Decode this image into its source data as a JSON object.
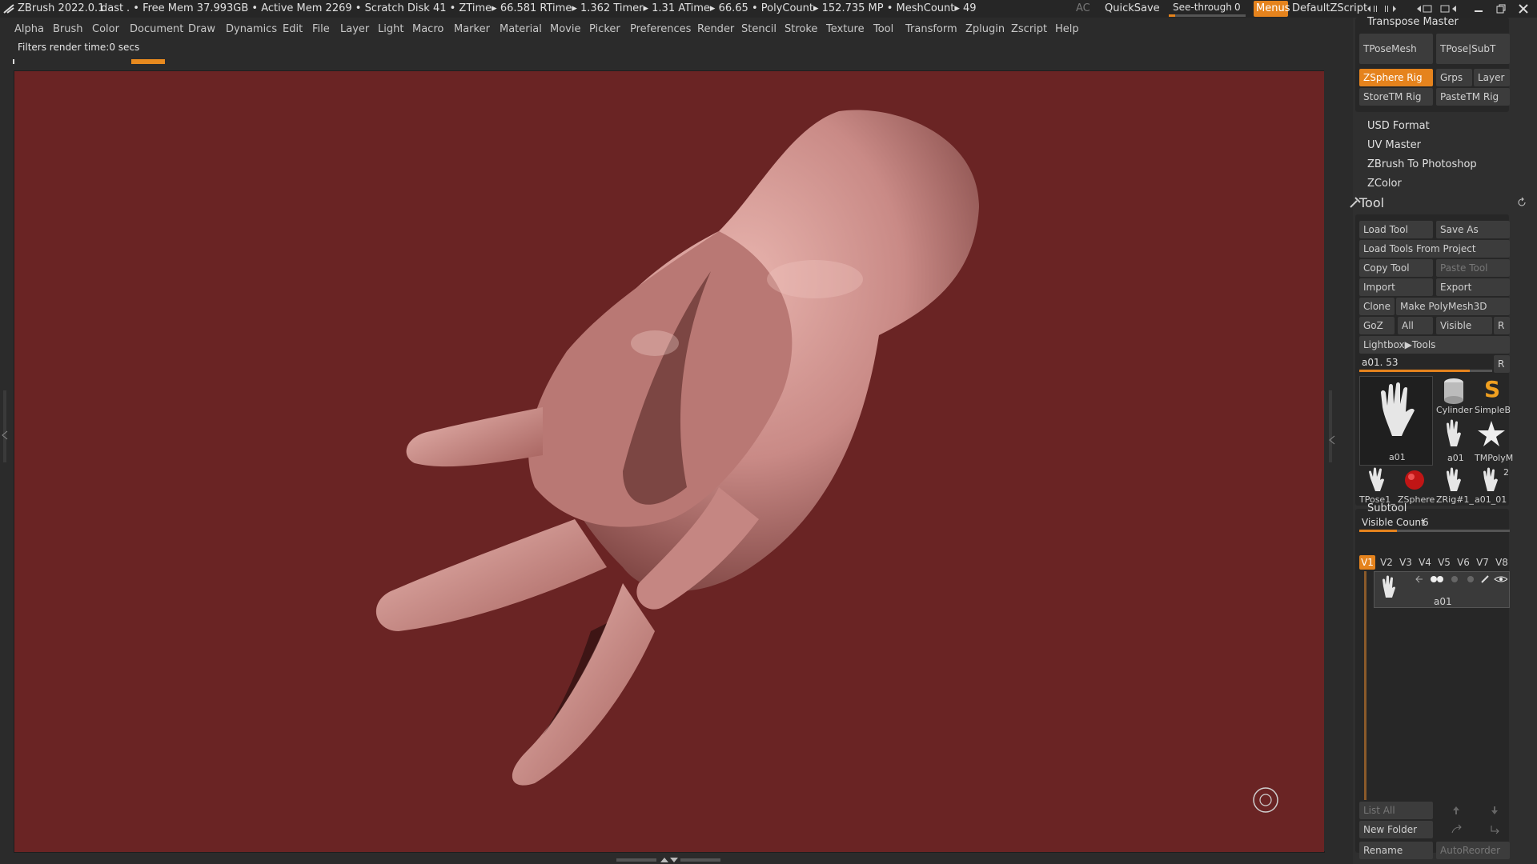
{
  "titlebar": {
    "app": "ZBrush 2022.0.1",
    "doc": "dast",
    "stats": ". • Free Mem 37.993GB • Active Mem 2269 • Scratch Disk 41 • ZTime▸ 66.581 RTime▸ 1.362 Timer▸ 1.31 ATime▸ 66.65 • PolyCount▸ 152.735 MP • MeshCount▸ 49",
    "ac": "AC",
    "quicksave": "QuickSave",
    "see_through_label": "See-through",
    "see_through_value": "0",
    "menus": "Menus",
    "default_zscript": "DefaultZScript"
  },
  "menubar": {
    "items": [
      "Alpha",
      "Brush",
      "Color",
      "Document",
      "Draw",
      "Dynamics",
      "Edit",
      "File",
      "Layer",
      "Light",
      "Macro",
      "Marker",
      "Material",
      "Movie",
      "Picker",
      "Preferences",
      "Render",
      "Stencil",
      "Stroke",
      "Texture",
      "Tool",
      "Transform",
      "Zplugin",
      "Zscript",
      "Help"
    ]
  },
  "note": "Filters render time:0 secs",
  "progress": 0.4,
  "colors": {
    "accent": "#e5831d",
    "canvas": "#6a2424",
    "panel": "#2f2f2f",
    "button": "#3c3c3c",
    "skin": "#c98a86"
  },
  "panel": {
    "transpose_master": "Transpose Master",
    "tposemesh": "TPoseMesh",
    "tpose_subt": "TPose|SubT",
    "zsphere_rig": "ZSphere Rig",
    "grps": "Grps",
    "layer": "Layer",
    "storetm_rig": "StoreTM Rig",
    "pastetm_rig": "PasteTM Rig",
    "plugins": [
      "USD Format",
      "UV Master",
      "ZBrush To Photoshop",
      "ZColor"
    ],
    "tool_title": "Tool",
    "load_tool": "Load Tool",
    "save_as": "Save As",
    "load_tools_from_project": "Load Tools From Project",
    "copy_tool": "Copy Tool",
    "paste_tool": "Paste Tool",
    "import": "Import",
    "export": "Export",
    "clone": "Clone",
    "make_polymesh3d": "Make PolyMesh3D",
    "goz": "GoZ",
    "all": "All",
    "visible": "Visible",
    "r": "R",
    "lightbox_tools": "Lightbox▶Tools",
    "tool_slider_label": "a01. 53",
    "tool_slider_value": 0.83,
    "thumbs": {
      "main": "a01",
      "cylinder": "Cylinder",
      "simpleb": "SimpleB",
      "a01_small": "a01",
      "tmpoly": "TMPolyM",
      "tpose1": "TPose1_",
      "zsphere": "ZSphere",
      "zrig": "ZRig#1_",
      "a01_01": "a01_01",
      "a01_01_count": "2"
    },
    "subtool_title": "Subtool",
    "visible_count_label": "Visible Count",
    "visible_count_value": "6",
    "visible_count_fill": 0.25,
    "vtabs": [
      "V1",
      "V2",
      "V3",
      "V4",
      "V5",
      "V6",
      "V7",
      "V8"
    ],
    "subtool_name": "a01",
    "list_all": "List All",
    "new_folder": "New Folder",
    "rename": "Rename",
    "autoreorder": "AutoReorder"
  }
}
